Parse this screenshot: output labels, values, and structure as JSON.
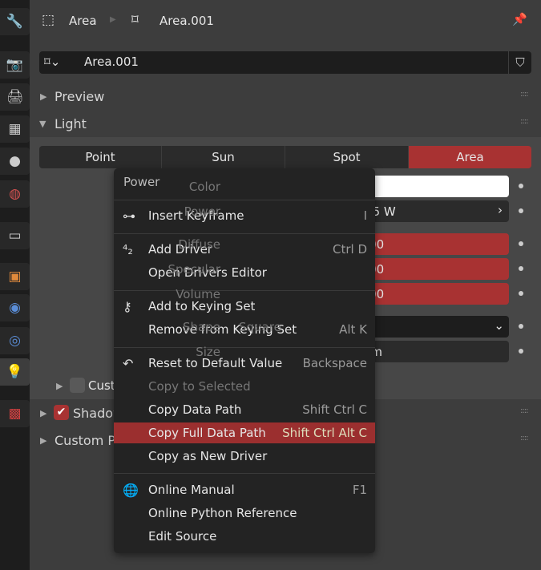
{
  "sidebar": {
    "tabs": [
      "tool-icon",
      "render-icon",
      "output-icon",
      "view-layer-icon",
      "scene-icon",
      "world-icon",
      "collection-icon",
      "object-icon",
      "modifier-icon",
      "physics-icon",
      "light-data-icon",
      "texture-icon"
    ]
  },
  "header": {
    "breadcrumb": [
      "Area",
      "Area.001"
    ],
    "datablock_name": "Area.001"
  },
  "panels": {
    "preview": "Preview",
    "light": "Light",
    "shadow": "Shadow",
    "custom_properties": "Custom Properties",
    "custom_distance": "Custom Distance"
  },
  "light_types": [
    "Point",
    "Sun",
    "Spot",
    "Area"
  ],
  "light_type_selected": "Area",
  "fields": {
    "color_label": "Color",
    "power_label": "Power",
    "power_value": "32.45 W",
    "diffuse_label": "Diffuse",
    "diffuse_value": "1.00",
    "specular_label": "Specular",
    "specular_value": "1.00",
    "volume_label": "Volume",
    "volume_value": "1.00",
    "shape_label": "Shape",
    "shape_value": "Square",
    "size_label": "Size",
    "size_value": "1 m"
  },
  "shadow_enabled": true,
  "custom_distance_enabled": false,
  "context_menu": {
    "title": "Power",
    "items": [
      {
        "label": "Insert Keyframe",
        "shortcut": "I"
      },
      {
        "label": "Add Driver",
        "shortcut": "Ctrl D"
      },
      {
        "label": "Open Drivers Editor",
        "shortcut": ""
      },
      {
        "label": "Add to Keying Set",
        "shortcut": ""
      },
      {
        "label": "Remove from Keying Set",
        "shortcut": "Alt K"
      },
      {
        "label": "Reset to Default Value",
        "shortcut": "Backspace"
      },
      {
        "label": "Copy to Selected",
        "shortcut": "",
        "disabled": true
      },
      {
        "label": "Copy Data Path",
        "shortcut": "Shift Ctrl C"
      },
      {
        "label": "Copy Full Data Path",
        "shortcut": "Shift Ctrl Alt C",
        "highlighted": true
      },
      {
        "label": "Copy as New Driver",
        "shortcut": ""
      },
      {
        "label": "Online Manual",
        "shortcut": "F1"
      },
      {
        "label": "Online Python Reference",
        "shortcut": ""
      },
      {
        "label": "Edit Source",
        "shortcut": ""
      }
    ]
  },
  "colors": {
    "accent": "#a83232",
    "highlight": "#9b2f2f",
    "menu_bg": "#232323"
  }
}
